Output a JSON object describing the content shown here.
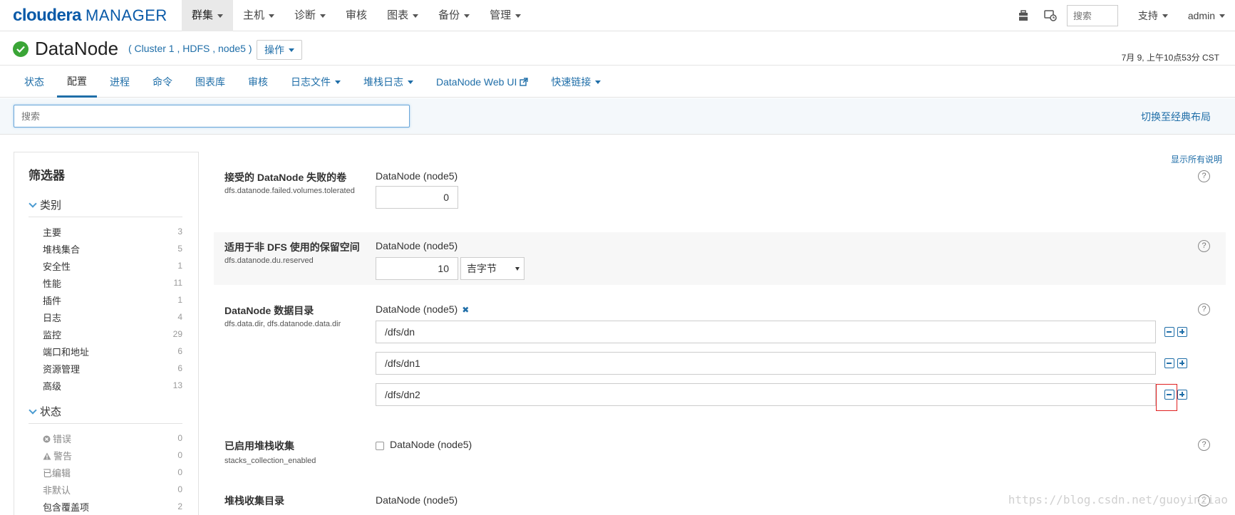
{
  "logo": {
    "brand": "cloudera",
    "product": "MANAGER"
  },
  "topnav": {
    "items": [
      {
        "label": "群集",
        "active": true,
        "dropdown": true
      },
      {
        "label": "主机",
        "dropdown": true
      },
      {
        "label": "诊断",
        "dropdown": true
      },
      {
        "label": "审核",
        "dropdown": false
      },
      {
        "label": "图表",
        "dropdown": true
      },
      {
        "label": "备份",
        "dropdown": true
      },
      {
        "label": "管理",
        "dropdown": true
      }
    ],
    "search_placeholder": "搜索",
    "support": "支持",
    "user": "admin"
  },
  "titlebar": {
    "title": "DataNode",
    "breadcrumb": "( Cluster 1 , HDFS , node5 )",
    "actions": "操作",
    "timestamp": "7月 9, 上午10点53分 CST"
  },
  "subtabs": {
    "items": [
      {
        "label": "状态"
      },
      {
        "label": "配置",
        "active": true
      },
      {
        "label": "进程"
      },
      {
        "label": "命令"
      },
      {
        "label": "图表库"
      },
      {
        "label": "审核"
      },
      {
        "label": "日志文件",
        "dropdown": true
      },
      {
        "label": "堆栈日志",
        "dropdown": true
      },
      {
        "label": "DataNode Web UI",
        "external": true
      },
      {
        "label": "快速链接",
        "dropdown": true
      }
    ]
  },
  "search": {
    "placeholder": "搜索",
    "switch_layout": "切换至经典布局"
  },
  "sidebar": {
    "title": "筛选器",
    "category": {
      "heading": "类别",
      "items": [
        {
          "label": "主要",
          "count": "3"
        },
        {
          "label": "堆栈集合",
          "count": "5"
        },
        {
          "label": "安全性",
          "count": "1"
        },
        {
          "label": "性能",
          "count": "11"
        },
        {
          "label": "插件",
          "count": "1"
        },
        {
          "label": "日志",
          "count": "4"
        },
        {
          "label": "监控",
          "count": "29"
        },
        {
          "label": "端口和地址",
          "count": "6"
        },
        {
          "label": "资源管理",
          "count": "6"
        },
        {
          "label": "高级",
          "count": "13"
        }
      ]
    },
    "state": {
      "heading": "状态",
      "items": [
        {
          "label": "错误",
          "count": "0",
          "icon": "error-icon"
        },
        {
          "label": "警告",
          "count": "0",
          "icon": "warning-icon"
        },
        {
          "label": "已编辑",
          "count": "0"
        },
        {
          "label": "非默认",
          "count": "0"
        },
        {
          "label": "包含覆盖项",
          "count": "2"
        }
      ]
    }
  },
  "main": {
    "show_all": "显示所有说明",
    "props": [
      {
        "name": "接受的 DataNode 失败的卷",
        "key": "dfs.datanode.failed.volumes.tolerated",
        "scope": "DataNode (node5)",
        "value": "0"
      },
      {
        "name": "适用于非 DFS 使用的保留空间",
        "key": "dfs.datanode.du.reserved",
        "scope": "DataNode (node5)",
        "value": "10",
        "unit": "吉字节"
      },
      {
        "name": "DataNode 数据目录",
        "key": "dfs.data.dir, dfs.datanode.data.dir",
        "scope": "DataNode (node5)",
        "paths": [
          "/dfs/dn",
          "/dfs/dn1",
          "/dfs/dn2"
        ]
      },
      {
        "name": "已启用堆栈收集",
        "key": "stacks_collection_enabled",
        "scope": "DataNode (node5)"
      },
      {
        "name": "堆栈收集目录",
        "scope": "DataNode (node5)"
      }
    ]
  },
  "watermark": "https://blog.csdn.net/guoyinziao",
  "colors": {
    "accent": "#1f6ea8",
    "ok": "#3aa536",
    "highlight": "#e02020"
  }
}
